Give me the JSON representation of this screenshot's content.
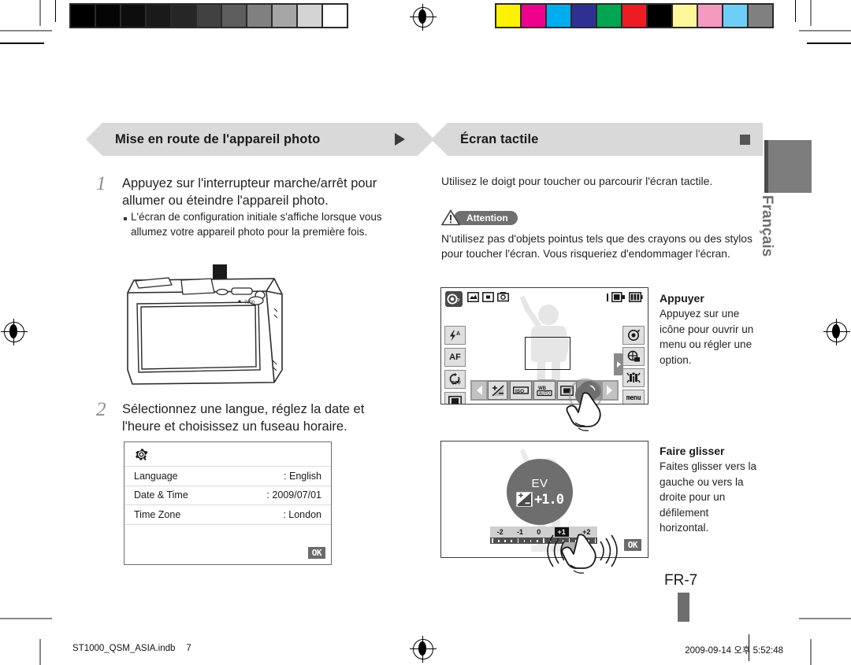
{
  "calibration": {
    "gray_patches": [
      "#000000",
      "#050505",
      "#0d0d0d",
      "#1a1a1a",
      "#262626",
      "#414141",
      "#5e5e5e",
      "#808080",
      "#a6a6a6",
      "#d4d4d4",
      "#ffffff"
    ],
    "color_patches": [
      "#fff200",
      "#ec008c",
      "#00aeef",
      "#2e3192",
      "#00a651",
      "#ed1c24",
      "#000000",
      "#fff79a",
      "#f49ac1",
      "#6dcff6",
      "#808080"
    ]
  },
  "left_column": {
    "section_title": "Mise en route de l'appareil photo",
    "section_marker_icon": "triangle-right-icon",
    "step1": {
      "number": "1",
      "text": "Appuyez sur l'interrupteur marche/arrêt pour allumer ou éteindre l'appareil photo.",
      "bullet": "L'écran de configuration initiale s'affiche lorsque vous allumez votre appareil photo pour la première fois."
    },
    "camera_illustration": {
      "caption_icon": "down-arrow-icon",
      "alt": "camera-front-illustration"
    },
    "step2": {
      "number": "2",
      "text": "Sélectionnez une langue, réglez la date et l'heure et choisissez un fuseau horaire."
    },
    "settings_screen": {
      "header_icon": "gear-icon",
      "rows": [
        {
          "label": "Language",
          "value": ": English"
        },
        {
          "label": "Date & Time",
          "value": ": 2009/07/01"
        },
        {
          "label": "Time Zone",
          "value": ": London"
        }
      ],
      "ok_label": "OK"
    }
  },
  "right_column": {
    "section_title": "Écran tactile",
    "section_marker_icon": "square-icon",
    "intro": "Utilisez le doigt pour toucher ou parcourir l'écran tactile.",
    "caution": {
      "icon": "warning-triangle-icon",
      "label": "Attention",
      "text": "N'utilisez pas d'objets pointus tels que des crayons ou des stylos pour toucher l'écran. Vous risqueriez d'endommager l'écran."
    },
    "touch_demo": {
      "lcd": {
        "mode_icon": "camera-mode-icon",
        "status_icons": [
          "image-size-icon",
          "metering-icon",
          "face-detect-icon"
        ],
        "right_status": [
          "memory-card-icon",
          "battery-icon"
        ],
        "left_buttons": [
          "flash-auto-icon",
          "af-icon",
          "timer-off-icon",
          "display-icon"
        ],
        "right_buttons": [
          "shooting-mode-icon",
          "scene-mode-icon",
          "sound-icon"
        ],
        "menu_label": "menu",
        "bottom_bar": [
          "chevron-left-icon",
          "exposure-icon",
          "iso-icon",
          "white-balance-icon",
          "face-frame-icon",
          "focus-icon",
          "chevron-right-icon"
        ],
        "cursor_icon": "hand-tap-icon"
      },
      "heading": "Appuyer",
      "text": "Appuyez sur une icône pour ouvrir un menu ou régler une option."
    },
    "drag_demo": {
      "lcd": {
        "dial_label": "EV",
        "dial_icon": "exposure-icon",
        "dial_value": "+1.0",
        "scale_ticks": [
          "-2",
          "-1",
          "0",
          "+1",
          "+2"
        ],
        "selected_tick": "+1",
        "ok_label": "OK",
        "cursor_icon": "hand-drag-icon"
      },
      "heading": "Faire glisser",
      "text": "Faites glisser vers la gauche ou vers la droite pour un défilement horizontal."
    },
    "language_tab": "Français"
  },
  "page": {
    "page_number": "FR-7"
  },
  "footer": {
    "file_name": "ST1000_QSM_ASIA.indb",
    "file_page": "7",
    "timestamp": "2009-09-14   오후 5:52:48",
    "registration_icon": "registration-mark-icon"
  }
}
